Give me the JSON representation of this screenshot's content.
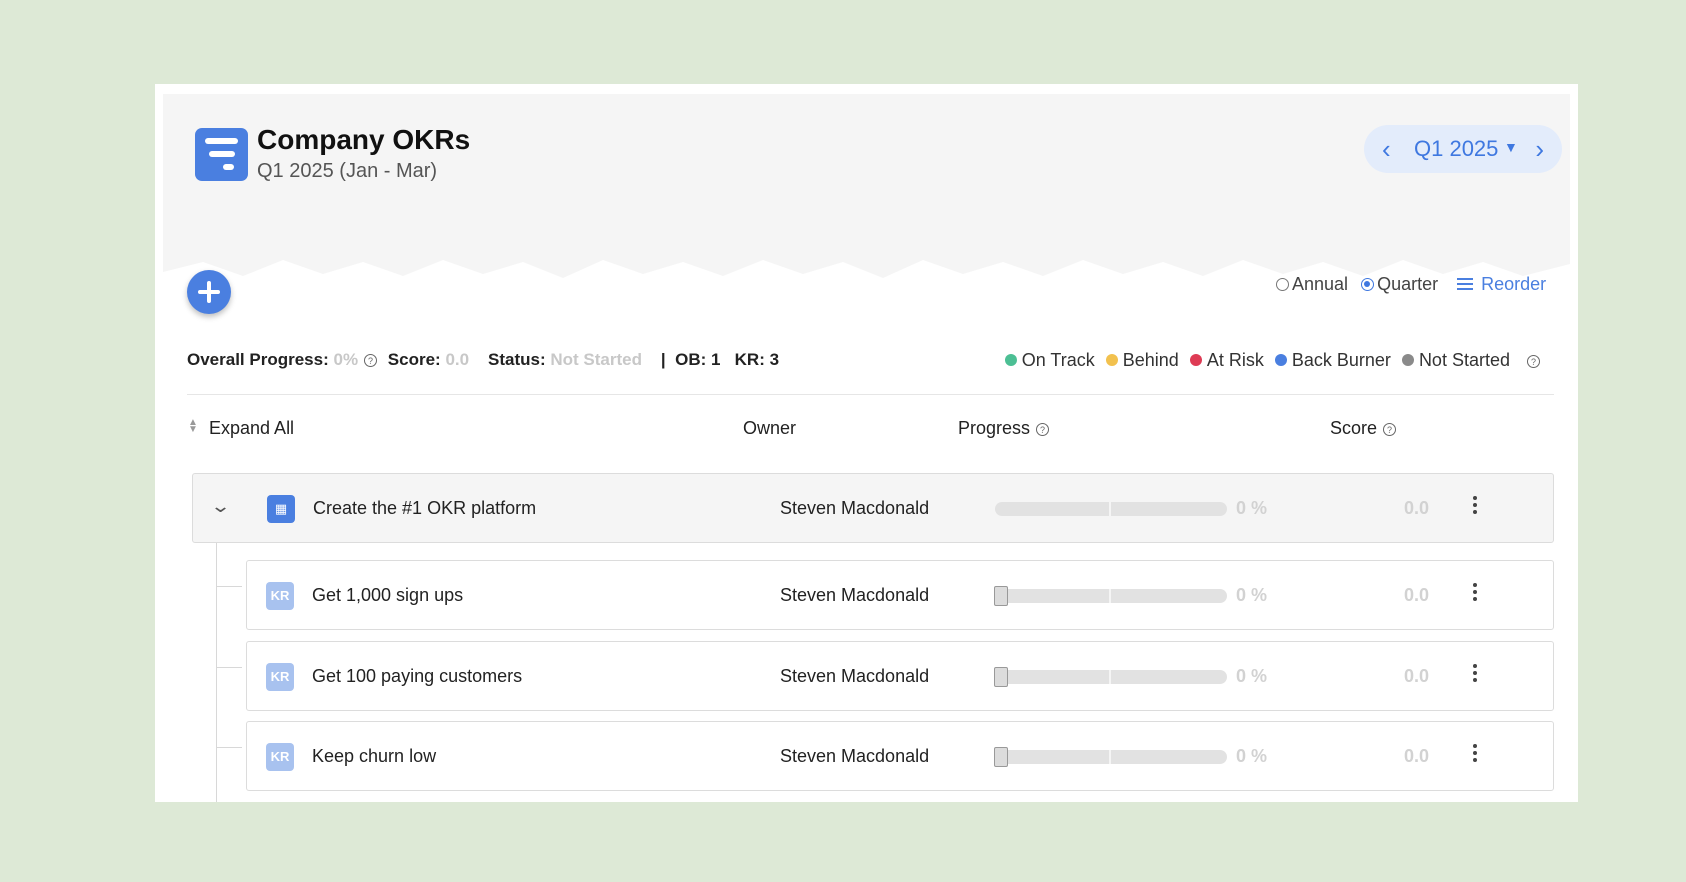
{
  "header": {
    "title": "Company OKRs",
    "subtitle": "Q1 2025 (Jan - Mar)",
    "period_label": "Q1 2025"
  },
  "view_options": {
    "annual_label": "Annual",
    "quarter_label": "Quarter",
    "selected": "Quarter",
    "reorder_label": "Reorder"
  },
  "summary": {
    "overall_progress_label": "Overall Progress:",
    "overall_progress_value": "0%",
    "score_label": "Score:",
    "score_value": "0.0",
    "status_label": "Status:",
    "status_value": "Not Started",
    "separator": "|",
    "ob_label": "OB:",
    "ob_value": "1",
    "kr_label": "KR:",
    "kr_value": "3"
  },
  "legend": [
    {
      "label": "On Track",
      "color": "#4cbf94"
    },
    {
      "label": "Behind",
      "color": "#f2c14e"
    },
    {
      "label": "At Risk",
      "color": "#de3b54"
    },
    {
      "label": "Back Burner",
      "color": "#4a7fe0"
    },
    {
      "label": "Not Started",
      "color": "#8a8a8a"
    }
  ],
  "columns": {
    "expand_all": "Expand All",
    "owner": "Owner",
    "progress": "Progress",
    "score": "Score"
  },
  "objective": {
    "name": "Create the #1 OKR platform",
    "owner": "Steven Macdonald",
    "progress_text": "0 %",
    "progress": 0,
    "score": "0.0"
  },
  "key_results": [
    {
      "icon_label": "KR",
      "name": "Get 1,000 sign ups",
      "owner": "Steven Macdonald",
      "progress_text": "0 %",
      "progress": 0,
      "score": "0.0"
    },
    {
      "icon_label": "KR",
      "name": "Get 100 paying customers",
      "owner": "Steven Macdonald",
      "progress_text": "0 %",
      "progress": 0,
      "score": "0.0"
    },
    {
      "icon_label": "KR",
      "name": "Keep churn low",
      "owner": "Steven Macdonald",
      "progress_text": "0 %",
      "progress": 0,
      "score": "0.0"
    }
  ],
  "icons": {
    "logo": "okr-logo-icon",
    "prev": "chevron-left-icon",
    "next": "chevron-right-icon",
    "dropdown": "caret-down-icon",
    "add": "plus-icon",
    "reorder": "hamburger-icon",
    "help": "question-circle-icon",
    "expand": "sort-icon",
    "collapse": "chevron-down-icon",
    "objective": "building-icon",
    "more": "kebab-icon"
  }
}
